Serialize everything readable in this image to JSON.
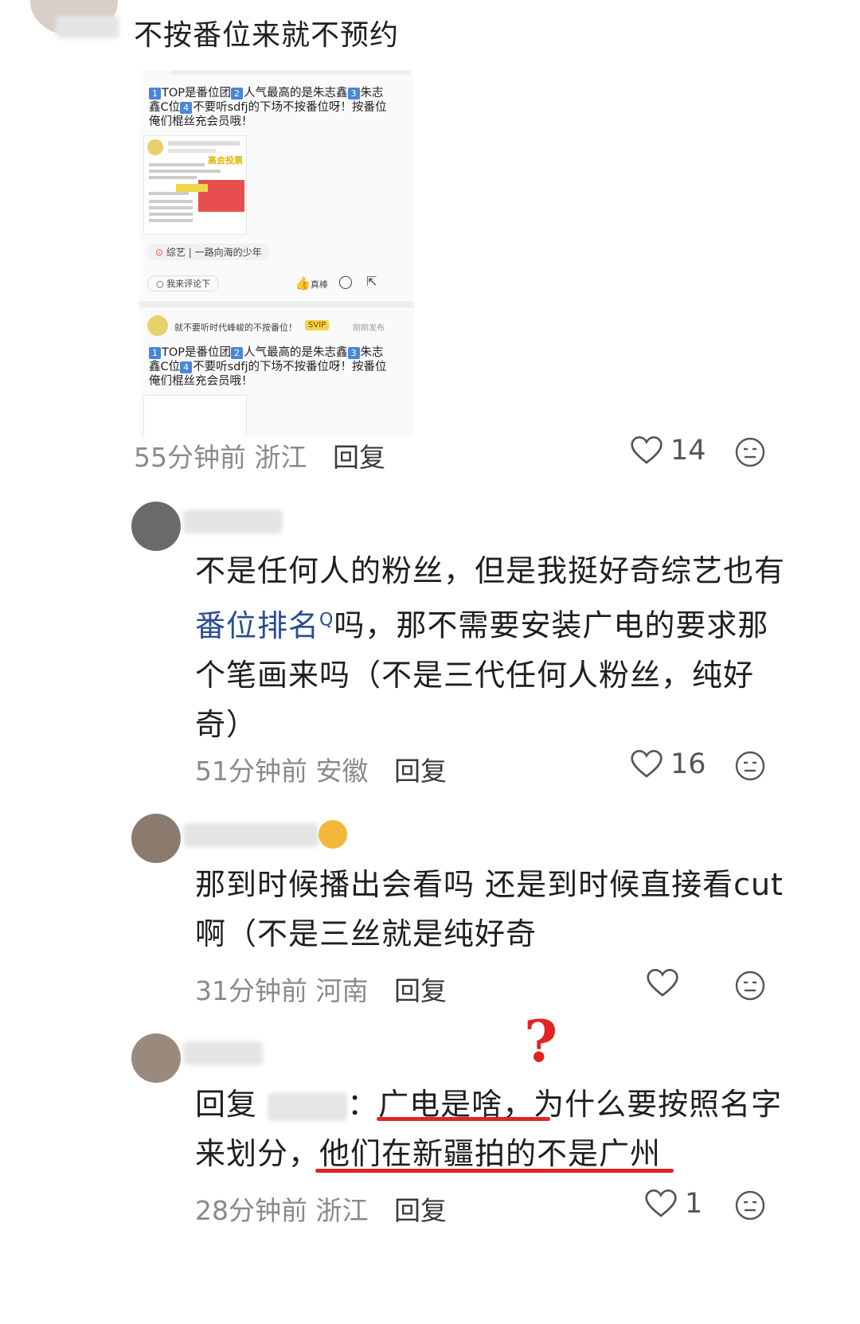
{
  "comments": [
    {
      "text": "不按番位来就不预约",
      "embed": {
        "post_lines": [
          "TOP是番位团",
          "人气最高的是朱志鑫",
          "朱志",
          "鑫C位",
          "不要听sdfj的下场不按番位呀！按番位",
          "俺们棍丝充会员哦！"
        ],
        "badge": "高会投票",
        "tag": "综艺 | 一路向海的少年",
        "comment_prompt": "我来评论下",
        "like_label": "真棒",
        "second_header": "就不要听时代峰峻的不按番位！",
        "svip": "SVIP",
        "time_label": "刚刚发布"
      },
      "time": "55分钟前",
      "location": "浙江",
      "reply": "回复",
      "likes": "14"
    },
    {
      "text_before": "不是任何人的粉丝，但是我挺好奇综艺也有",
      "link": "番位排名",
      "text_after": "吗，那不需要安装广电的要求那个笔画来吗（不是三代任何人粉丝，纯好奇）",
      "time": "51分钟前",
      "location": "安徽",
      "reply": "回复",
      "likes": "16"
    },
    {
      "text": "那到时候播出会看吗 还是到时候直接看cut啊（不是三丝就是纯好奇",
      "time": "31分钟前",
      "location": "河南",
      "reply": "回复",
      "likes": ""
    },
    {
      "prefix": "回复",
      "colon": "：",
      "text": "广电是啥，为什么要按照名字来划分，他们在新疆拍的不是广州",
      "mark": "?",
      "time": "28分钟前",
      "location": "浙江",
      "reply": "回复",
      "likes": "1"
    }
  ],
  "colors": {
    "accent_red": "#e02424",
    "link_blue": "#2a4d8f",
    "meta_gray": "#8a8a8a"
  },
  "icons": [
    "heart-icon",
    "neutral-face-icon"
  ]
}
